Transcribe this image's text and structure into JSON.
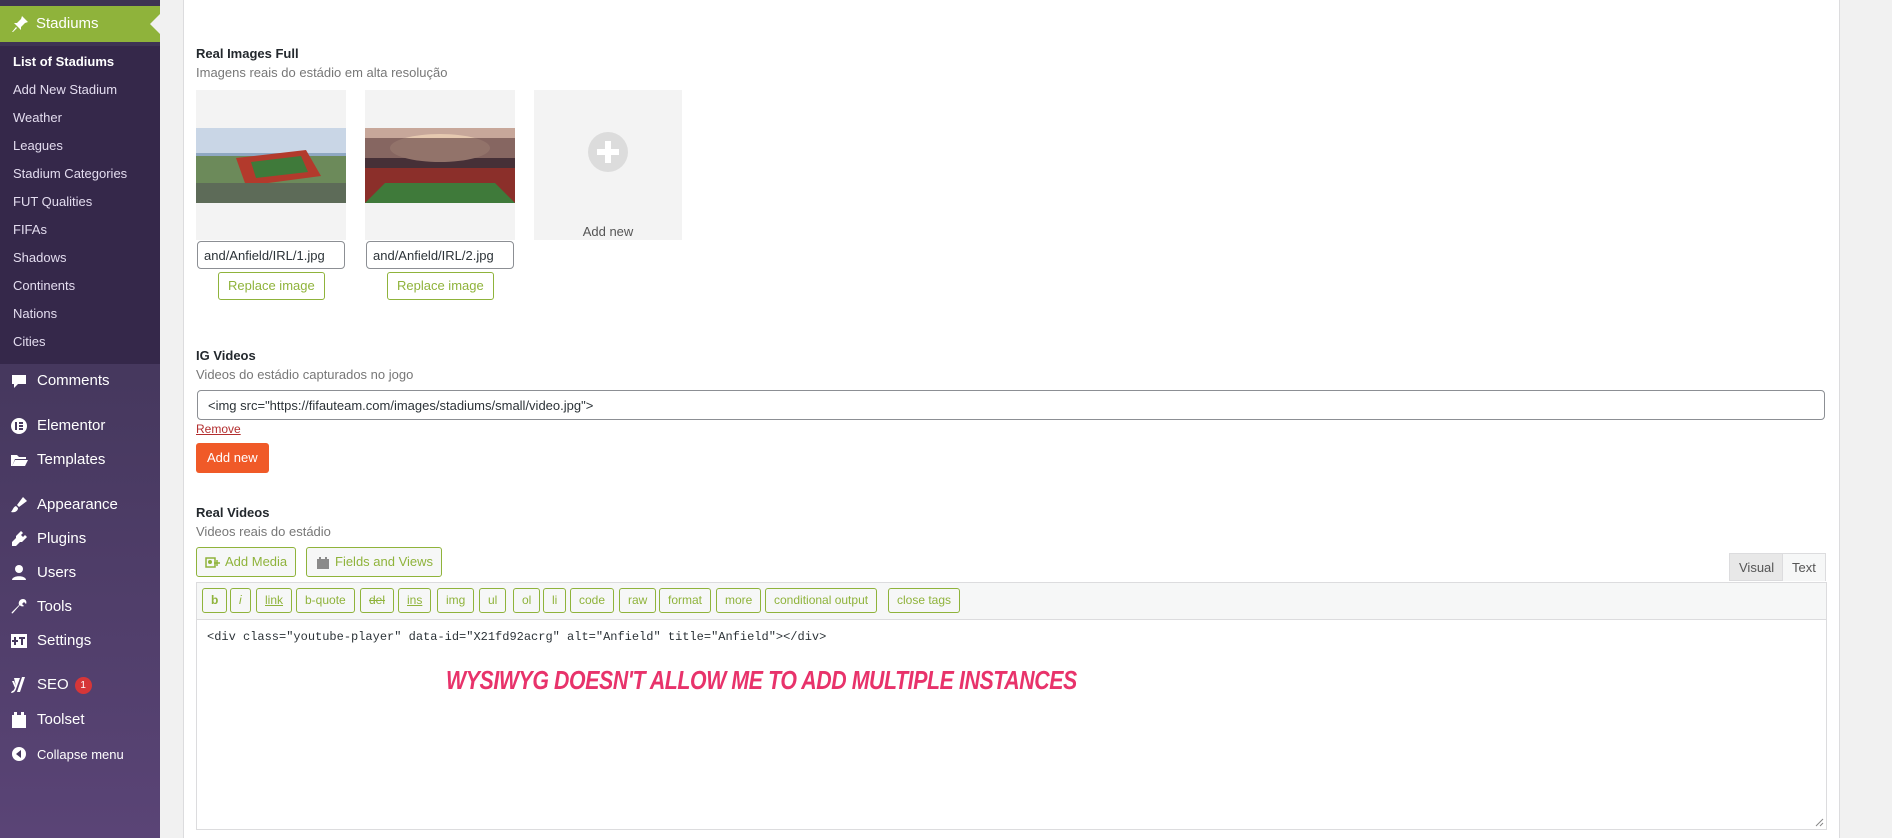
{
  "sidebar": {
    "current": {
      "label": "Stadiums",
      "icon": "pin-icon"
    },
    "submenu": [
      {
        "label": "List of Stadiums",
        "active": true
      },
      {
        "label": "Add New Stadium"
      },
      {
        "label": "Weather"
      },
      {
        "label": "Leagues"
      },
      {
        "label": "Stadium Categories"
      },
      {
        "label": "FUT Qualities"
      },
      {
        "label": "FIFAs"
      },
      {
        "label": "Shadows"
      },
      {
        "label": "Continents"
      },
      {
        "label": "Nations"
      },
      {
        "label": "Cities"
      }
    ],
    "menu": [
      {
        "label": "Comments",
        "icon": "comment-icon"
      },
      {
        "label": "Elementor",
        "icon": "elementor-icon"
      },
      {
        "label": "Templates",
        "icon": "folder-icon"
      },
      {
        "label": "Appearance",
        "icon": "brush-icon"
      },
      {
        "label": "Plugins",
        "icon": "plug-icon"
      },
      {
        "label": "Users",
        "icon": "user-icon"
      },
      {
        "label": "Tools",
        "icon": "wrench-icon"
      },
      {
        "label": "Settings",
        "icon": "settings-icon"
      },
      {
        "label": "SEO",
        "icon": "yoast-icon",
        "badge": "1"
      },
      {
        "label": "Toolset",
        "icon": "toolset-icon"
      },
      {
        "label": "Collapse menu",
        "icon": "collapse-icon"
      }
    ]
  },
  "real_images": {
    "title": "Real Images Full",
    "description": "Imagens reais do estádio em alta resolução",
    "images": [
      {
        "path": "and/Anfield/IRL/1.jpg",
        "replace_label": "Replace image"
      },
      {
        "path": "and/Anfield/IRL/2.jpg",
        "replace_label": "Replace image"
      }
    ],
    "add_new_label": "Add new"
  },
  "ig_videos": {
    "title": "IG Videos",
    "description": "Videos do estádio capturados no jogo",
    "value": "<img src=\"https://fifauteam.com/images/stadiums/small/video.jpg\">",
    "remove_label": "Remove",
    "add_new_label": "Add new"
  },
  "real_videos": {
    "title": "Real Videos",
    "description": "Videos reais do estádio",
    "add_media_label": "Add Media",
    "fields_views_label": "Fields and Views",
    "tabs": {
      "visual": "Visual",
      "text": "Text"
    },
    "quicktags": [
      "b",
      "i",
      "link",
      "b-quote",
      "del",
      "ins",
      "img",
      "ul",
      "ol",
      "li",
      "code",
      "raw",
      "format",
      "more",
      "conditional output",
      "close tags"
    ],
    "content": "<div class=\"youtube-player\" data-id=\"X21fd92acrg\" alt=\"Anfield\" title=\"Anfield\"></div>"
  },
  "annotation": "WYSIWYG  DOESN'T ALLOW ME TO ADD MULTIPLE INSTANCES",
  "colors": {
    "accent_green": "#8fb33b",
    "add_button": "#f05a28",
    "annotation": "#e8336b",
    "sidebar": "#46385e"
  }
}
